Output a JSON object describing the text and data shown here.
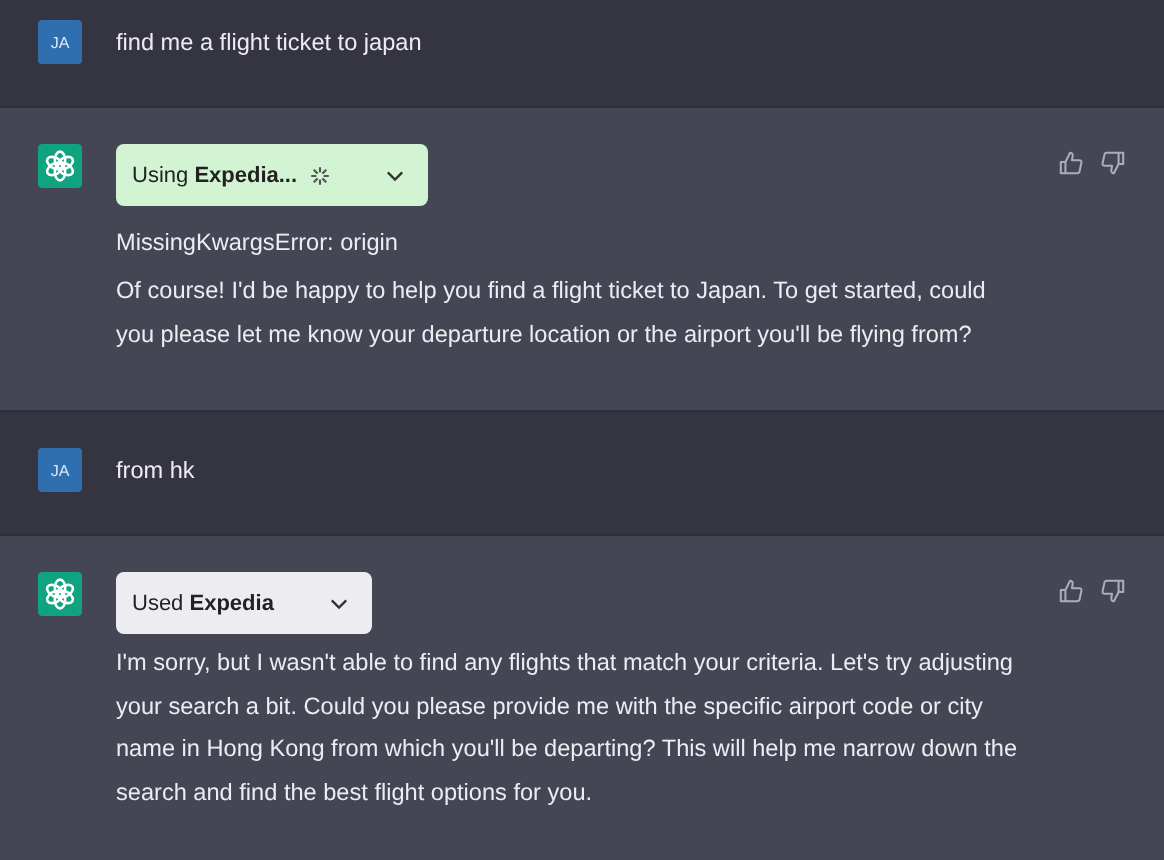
{
  "messages": [
    {
      "kind": "user",
      "avatar": "JA",
      "text": "find me a flight ticket to japan"
    },
    {
      "kind": "assistant",
      "plugin": {
        "running": true,
        "label": "Using **Expedia...**"
      },
      "error": "MissingKwargsError: origin",
      "text": "Of course! I'd be happy to help you find a flight ticket to Japan. To get started, could you please let me know your departure location or the airport you'll be flying from?"
    },
    {
      "kind": "user",
      "avatar": "JA",
      "text": "from hk"
    },
    {
      "kind": "assistant",
      "plugin": {
        "running": false,
        "label": "Used **Expedia**"
      },
      "text": "I'm sorry, but I wasn't able to find any flights that match your criteria. Let's try adjusting your search a bit. Could you please provide me with the specific airport code or city name in Hong Kong from which you'll be departing? This will help me narrow down the search and find the best flight options for you."
    }
  ]
}
